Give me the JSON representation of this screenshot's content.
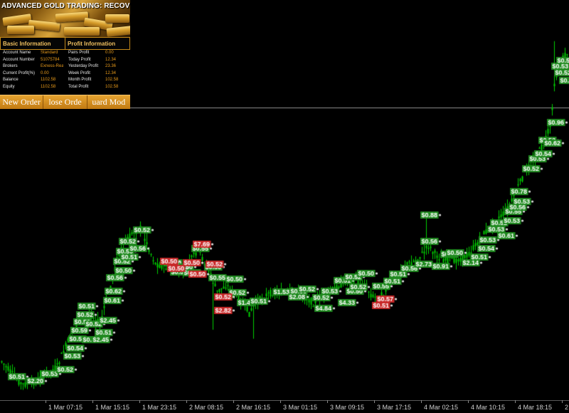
{
  "panel": {
    "title": "ADVANCED GOLD TRADING: RECOVERY",
    "basic_header": "Basic Information",
    "profit_header": "Profit Information",
    "basic_rows": [
      {
        "label": "Account Name",
        "value": "Standard"
      },
      {
        "label": "Account Number",
        "value": "51075784"
      },
      {
        "label": "Brokers",
        "value": "Exness-Real"
      },
      {
        "label": "Current Profit(%)",
        "value": "0.00"
      },
      {
        "label": "Balance",
        "value": "1102.58"
      },
      {
        "label": "Equity",
        "value": "1102.58"
      }
    ],
    "profit_rows": [
      {
        "label": "Pairs Profit",
        "value": "0.00"
      },
      {
        "label": "Today Profit",
        "value": "12.34"
      },
      {
        "label": "Yesterday Profit",
        "value": "23.36"
      },
      {
        "label": "Week Profit",
        "value": "12.34"
      },
      {
        "label": "Month Profit",
        "value": "102.58"
      },
      {
        "label": "Total Profit",
        "value": "102.58"
      }
    ],
    "buttons": [
      "New Order",
      "lose Orde",
      "uard Mod"
    ]
  },
  "colors": {
    "background": "#000000",
    "bull_candle": "#00d000",
    "profit_label_bg": "#1f8a1f",
    "loss_label_bg": "#c82828",
    "panel_accent": "#e0a02a",
    "price_line": "#a0a0a0"
  },
  "chart_data": {
    "type": "candlestick",
    "x_ticks": [
      "1 Mar 07:15",
      "1 Mar 15:15",
      "1 Mar 23:15",
      "2 Mar 08:15",
      "2 Mar 16:15",
      "3 Mar 01:15",
      "3 Mar 09:15",
      "3 Mar 17:15",
      "4 Mar 02:15",
      "4 Mar 10:15",
      "4 Mar 18:15",
      "2"
    ],
    "profit_labels": [
      "$0.51",
      "$2.20",
      "$0.53",
      "$0.52",
      "$0.53",
      "$0.54",
      "$0.53",
      "$0.59",
      "$0.52",
      "$0.52",
      "$0.51",
      "$0.53",
      "$0.52",
      "$0.51",
      "$2.45",
      "$0.61",
      "$2.45",
      "$0.62",
      "$0.56",
      "$0.50",
      "$0.52",
      "$0.50",
      "$0.52",
      "$0.56",
      "$0.52",
      "$0.51",
      "$0.50",
      "$0.50",
      "$0.50",
      "$0.50",
      "$0.55",
      "$0.56",
      "$0.55",
      "$0.50",
      "$0.52",
      "$1.46",
      "$0.51",
      "$1.53",
      "$0.53",
      "$2.08",
      "$0.52",
      "$0.52",
      "$0.53",
      "$4.84",
      "$4.33",
      "$0.50",
      "$0.51",
      "$0.52",
      "$0.52",
      "$0.50",
      "$0.55",
      "$0.51",
      "$0.51",
      "$0.56",
      "$2.73",
      "$0.56",
      "$0.50",
      "$0.50",
      "$0.91",
      "$2.14",
      "$0.88",
      "$0.51",
      "$0.54",
      "$0.53",
      "$0.61",
      "$0.53",
      "$0.52",
      "$0.53",
      "$0.55",
      "$0.56",
      "$0.78",
      "$0.53",
      "$0.52",
      "$0.53",
      "$0.54",
      "$0.53",
      "$0.62",
      "$0.96",
      "$0.53",
      "$0.52",
      "$0.51",
      "$0.52"
    ],
    "loss_labels": [
      "$0.50",
      "$0.50",
      "$0.50",
      "$0.50",
      "$7.69",
      "$0.52",
      "$2.82",
      "$0.52",
      "$0.57",
      "$0.51"
    ]
  }
}
